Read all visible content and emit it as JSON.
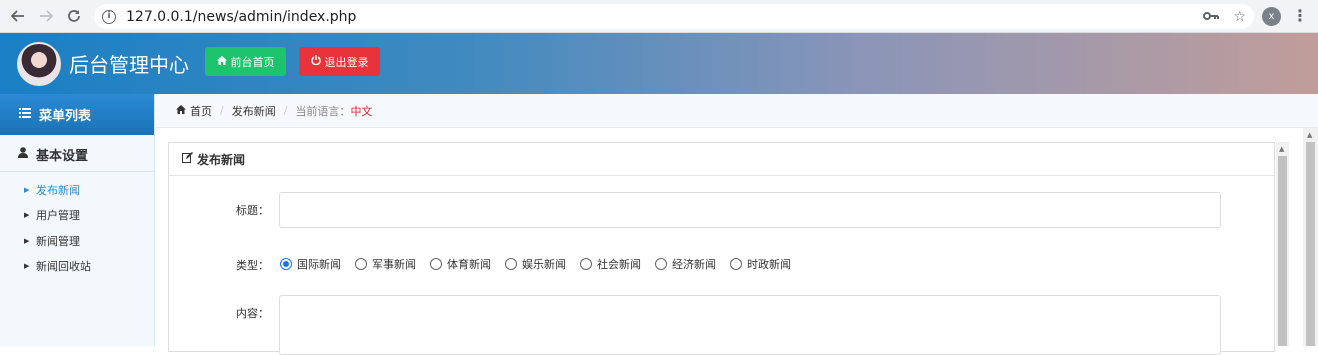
{
  "browser": {
    "url": "127.0.0.1/news/admin/index.php",
    "profile_initial": "x"
  },
  "header": {
    "title": "后台管理中心",
    "home_button": "前台首页",
    "logout_button": "退出登录"
  },
  "sidebar": {
    "menu_title": "菜单列表",
    "group_title": "基本设置",
    "items": [
      {
        "label": "发布新闻"
      },
      {
        "label": "用户管理"
      },
      {
        "label": "新闻管理"
      },
      {
        "label": "新闻回收站"
      }
    ]
  },
  "breadcrumb": {
    "home": "首页",
    "current": "发布新闻",
    "lang_label": "当前语言：",
    "lang_value": "中文"
  },
  "panel": {
    "title": "发布新闻",
    "title_label": "标题：",
    "type_label": "类型：",
    "content_label": "内容：",
    "types": [
      "国际新闻",
      "军事新闻",
      "体育新闻",
      "娱乐新闻",
      "社会新闻",
      "经济新闻",
      "时政新闻"
    ],
    "selected_type": "国际新闻"
  },
  "colors": {
    "accent": "#2a8ad3",
    "home_button": "#1ec46d",
    "logout_button": "#e8333a",
    "lang_value": "#d9242b"
  },
  "icons": [
    "back-icon",
    "forward-icon",
    "reload-icon",
    "info-icon",
    "key-icon",
    "star-icon",
    "more-icon",
    "home-icon",
    "power-icon",
    "list-icon",
    "user-icon",
    "edit-icon"
  ]
}
